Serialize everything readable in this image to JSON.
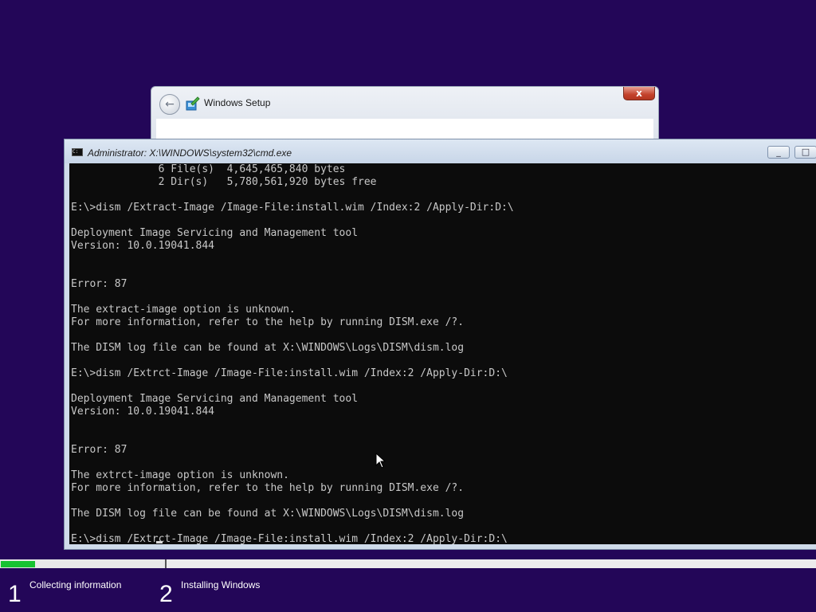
{
  "setup_window": {
    "title": "Windows Setup",
    "close_label": "x"
  },
  "cmd_window": {
    "title": "Administrator: X:\\WINDOWS\\system32\\cmd.exe",
    "minimize_label": "_",
    "maximize_label": "□",
    "lines": [
      "              6 File(s)  4,645,465,840 bytes",
      "              2 Dir(s)   5,780,561,920 bytes free",
      "",
      "E:\\>dism /Extract-Image /Image-File:install.wim /Index:2 /Apply-Dir:D:\\",
      "",
      "Deployment Image Servicing and Management tool",
      "Version: 10.0.19041.844",
      "",
      "",
      "Error: 87",
      "",
      "The extract-image option is unknown.",
      "For more information, refer to the help by running DISM.exe /?.",
      "",
      "The DISM log file can be found at X:\\WINDOWS\\Logs\\DISM\\dism.log",
      "",
      "E:\\>dism /Extrct-Image /Image-File:install.wim /Index:2 /Apply-Dir:D:\\",
      "",
      "Deployment Image Servicing and Management tool",
      "Version: 10.0.19041.844",
      "",
      "",
      "Error: 87",
      "",
      "The extrct-image option is unknown.",
      "For more information, refer to the help by running DISM.exe /?.",
      "",
      "The DISM log file can be found at X:\\WINDOWS\\Logs\\DISM\\dism.log",
      "",
      "E:\\>dism /Extrct-Image /Image-File:install.wim /Index:2 /Apply-Dir:D:\\"
    ]
  },
  "progress": {
    "step1_fraction": 0.21,
    "fill_color": "#17c231"
  },
  "steps": [
    {
      "number": "1",
      "label": "Collecting information"
    },
    {
      "number": "2",
      "label": "Installing Windows"
    }
  ],
  "colors": {
    "desktop_background": "#230658",
    "console_background": "#0c0c0c",
    "console_text": "#c8c8c8"
  }
}
